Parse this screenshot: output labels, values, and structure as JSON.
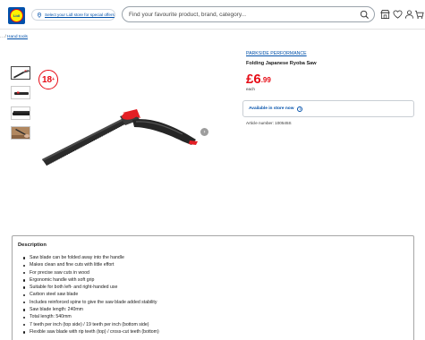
{
  "header": {
    "logo_text": "Lidl",
    "store_selector": "Select your Lidl store for special offers",
    "search_placeholder": "Find your favourite product, brand, category..."
  },
  "breadcrumb": {
    "prefix": "... /",
    "item": "Hand tools"
  },
  "product": {
    "age_restriction": "18",
    "age_plus": "+",
    "brand": "PARKSIDE PERFORMANCE",
    "title": "Folding Japanese Ryoba Saw",
    "price_main": "£6",
    "price_decimal": ".99",
    "price_unit": "each",
    "availability": "Available in store now",
    "article_number": "Article number: 100545S",
    "colors": {
      "price": "#e60a14",
      "link": "#0050aa",
      "handle_accent": "#e31e24"
    }
  },
  "description": {
    "title": "Description",
    "items": [
      "Saw blade can be folded away into the handle",
      "Makes clean and fine cuts with little effort",
      "For precise saw cuts in wood",
      "Ergonomic handle with soft grip",
      "Suitable for both left- and right-handed use",
      "Carbon steel saw blade",
      "Includes reinforced spine to give the saw blade added stability",
      "Saw blade length: 240mm",
      "Total length: 540mm",
      "7 teeth per inch (top side) / 19 teeth per inch (bottom side)",
      "Flexible saw blade with rip teeth (top) / cross-cut teeth (bottom)"
    ]
  },
  "icons": {
    "header": [
      "search-icon",
      "store-icon",
      "favourites-icon",
      "user-icon",
      "basket-icon"
    ],
    "store_pin": "location-pin-icon"
  }
}
